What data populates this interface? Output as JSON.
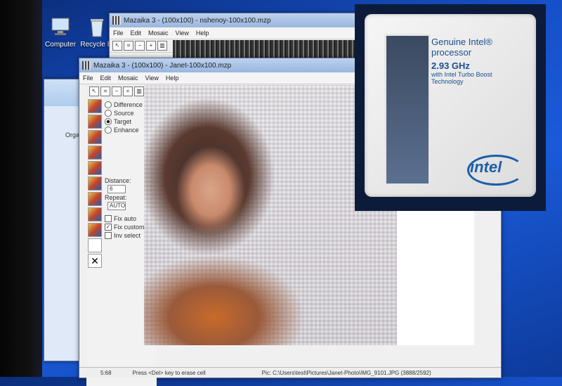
{
  "desktop": {
    "icons": [
      {
        "label": "Computer",
        "icon": "computer-icon"
      },
      {
        "label": "Recycle Bi",
        "icon": "recycle-bin-icon"
      }
    ]
  },
  "explorer": {
    "organize": "Orga"
  },
  "back_window": {
    "title": "Mazaika 3 - (100x100) - nshenoy-100x100.mzp",
    "menu": [
      "File",
      "Edit",
      "Mosaic",
      "View",
      "Help"
    ]
  },
  "main_window": {
    "title": "Mazaika 3 - (100x100) - Janet-100x100.mzp",
    "menu": [
      "File",
      "Edit",
      "Mosaic",
      "View",
      "Help"
    ],
    "options": {
      "modes": [
        {
          "label": "Difference",
          "selected": false
        },
        {
          "label": "Source",
          "selected": false
        },
        {
          "label": "Target",
          "selected": true
        },
        {
          "label": "Enhance",
          "selected": false
        }
      ],
      "distance_label": "Distance:",
      "distance_value": "6",
      "repeat_label": "Repeat:",
      "repeat_value": "AUTO",
      "fix_auto": "Fix auto",
      "fix_custom": "Fix custom",
      "inv_select": "Inv select"
    },
    "status": {
      "cell": "5:68",
      "hint": "Press <Del> key to erase cell",
      "pic": "Pic: C:\\Users\\test\\Pictures\\Janet-Photo\\IMG_9101.JPG (3888/2592)"
    }
  },
  "intel_badge": {
    "line1": "Genuine Intel®",
    "line2": "processor",
    "speed": "2.93 GHz",
    "turbo": "with Intel Turbo Boost",
    "tech": "Technology",
    "logo": "intel"
  }
}
